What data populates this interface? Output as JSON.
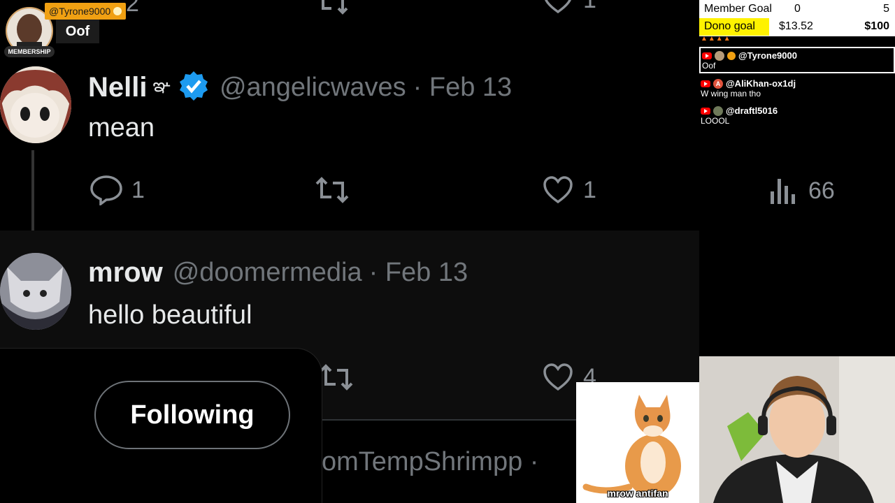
{
  "alert": {
    "username": "@Tyrone9000",
    "message": "Oof",
    "badge": "MEMBERSHIP"
  },
  "top_partial_stats": {
    "reply_count": "2",
    "like_count": "1"
  },
  "tweet1": {
    "display_name": "Nelli",
    "handle": "@angelicwaves",
    "date": "· Feb 13",
    "text": "mean",
    "replies": "1",
    "likes": "1",
    "views": "66"
  },
  "tweet2": {
    "display_name": "mrow",
    "handle": "@doomermedia",
    "date": "· Feb 13",
    "text": "hello beautiful",
    "likes": "4"
  },
  "follow_button": {
    "label": "Following"
  },
  "next_tweet_partial": {
    "handle_fragment": "omTempShrimpp ·"
  },
  "goals": {
    "member_label": "Member Goal",
    "member_current": "0",
    "member_target": "5",
    "dono_label": "Dono goal",
    "dono_current": "$13.52",
    "dono_target": "$100",
    "dono_progress": 0.1352,
    "dono_color": "#fff200"
  },
  "chat": [
    {
      "username": "@Tyrone9000",
      "message": "Oof"
    },
    {
      "username": "@AliKhan-ox1dj",
      "message": "W wing man tho"
    },
    {
      "username": "@draftl5016",
      "message": "LOOOL"
    }
  ],
  "overlay": {
    "caption": "mrow antifan"
  },
  "colors": {
    "verified": "#1d9bf0",
    "youtube": "#ff0000",
    "alert": "#f0a012"
  }
}
